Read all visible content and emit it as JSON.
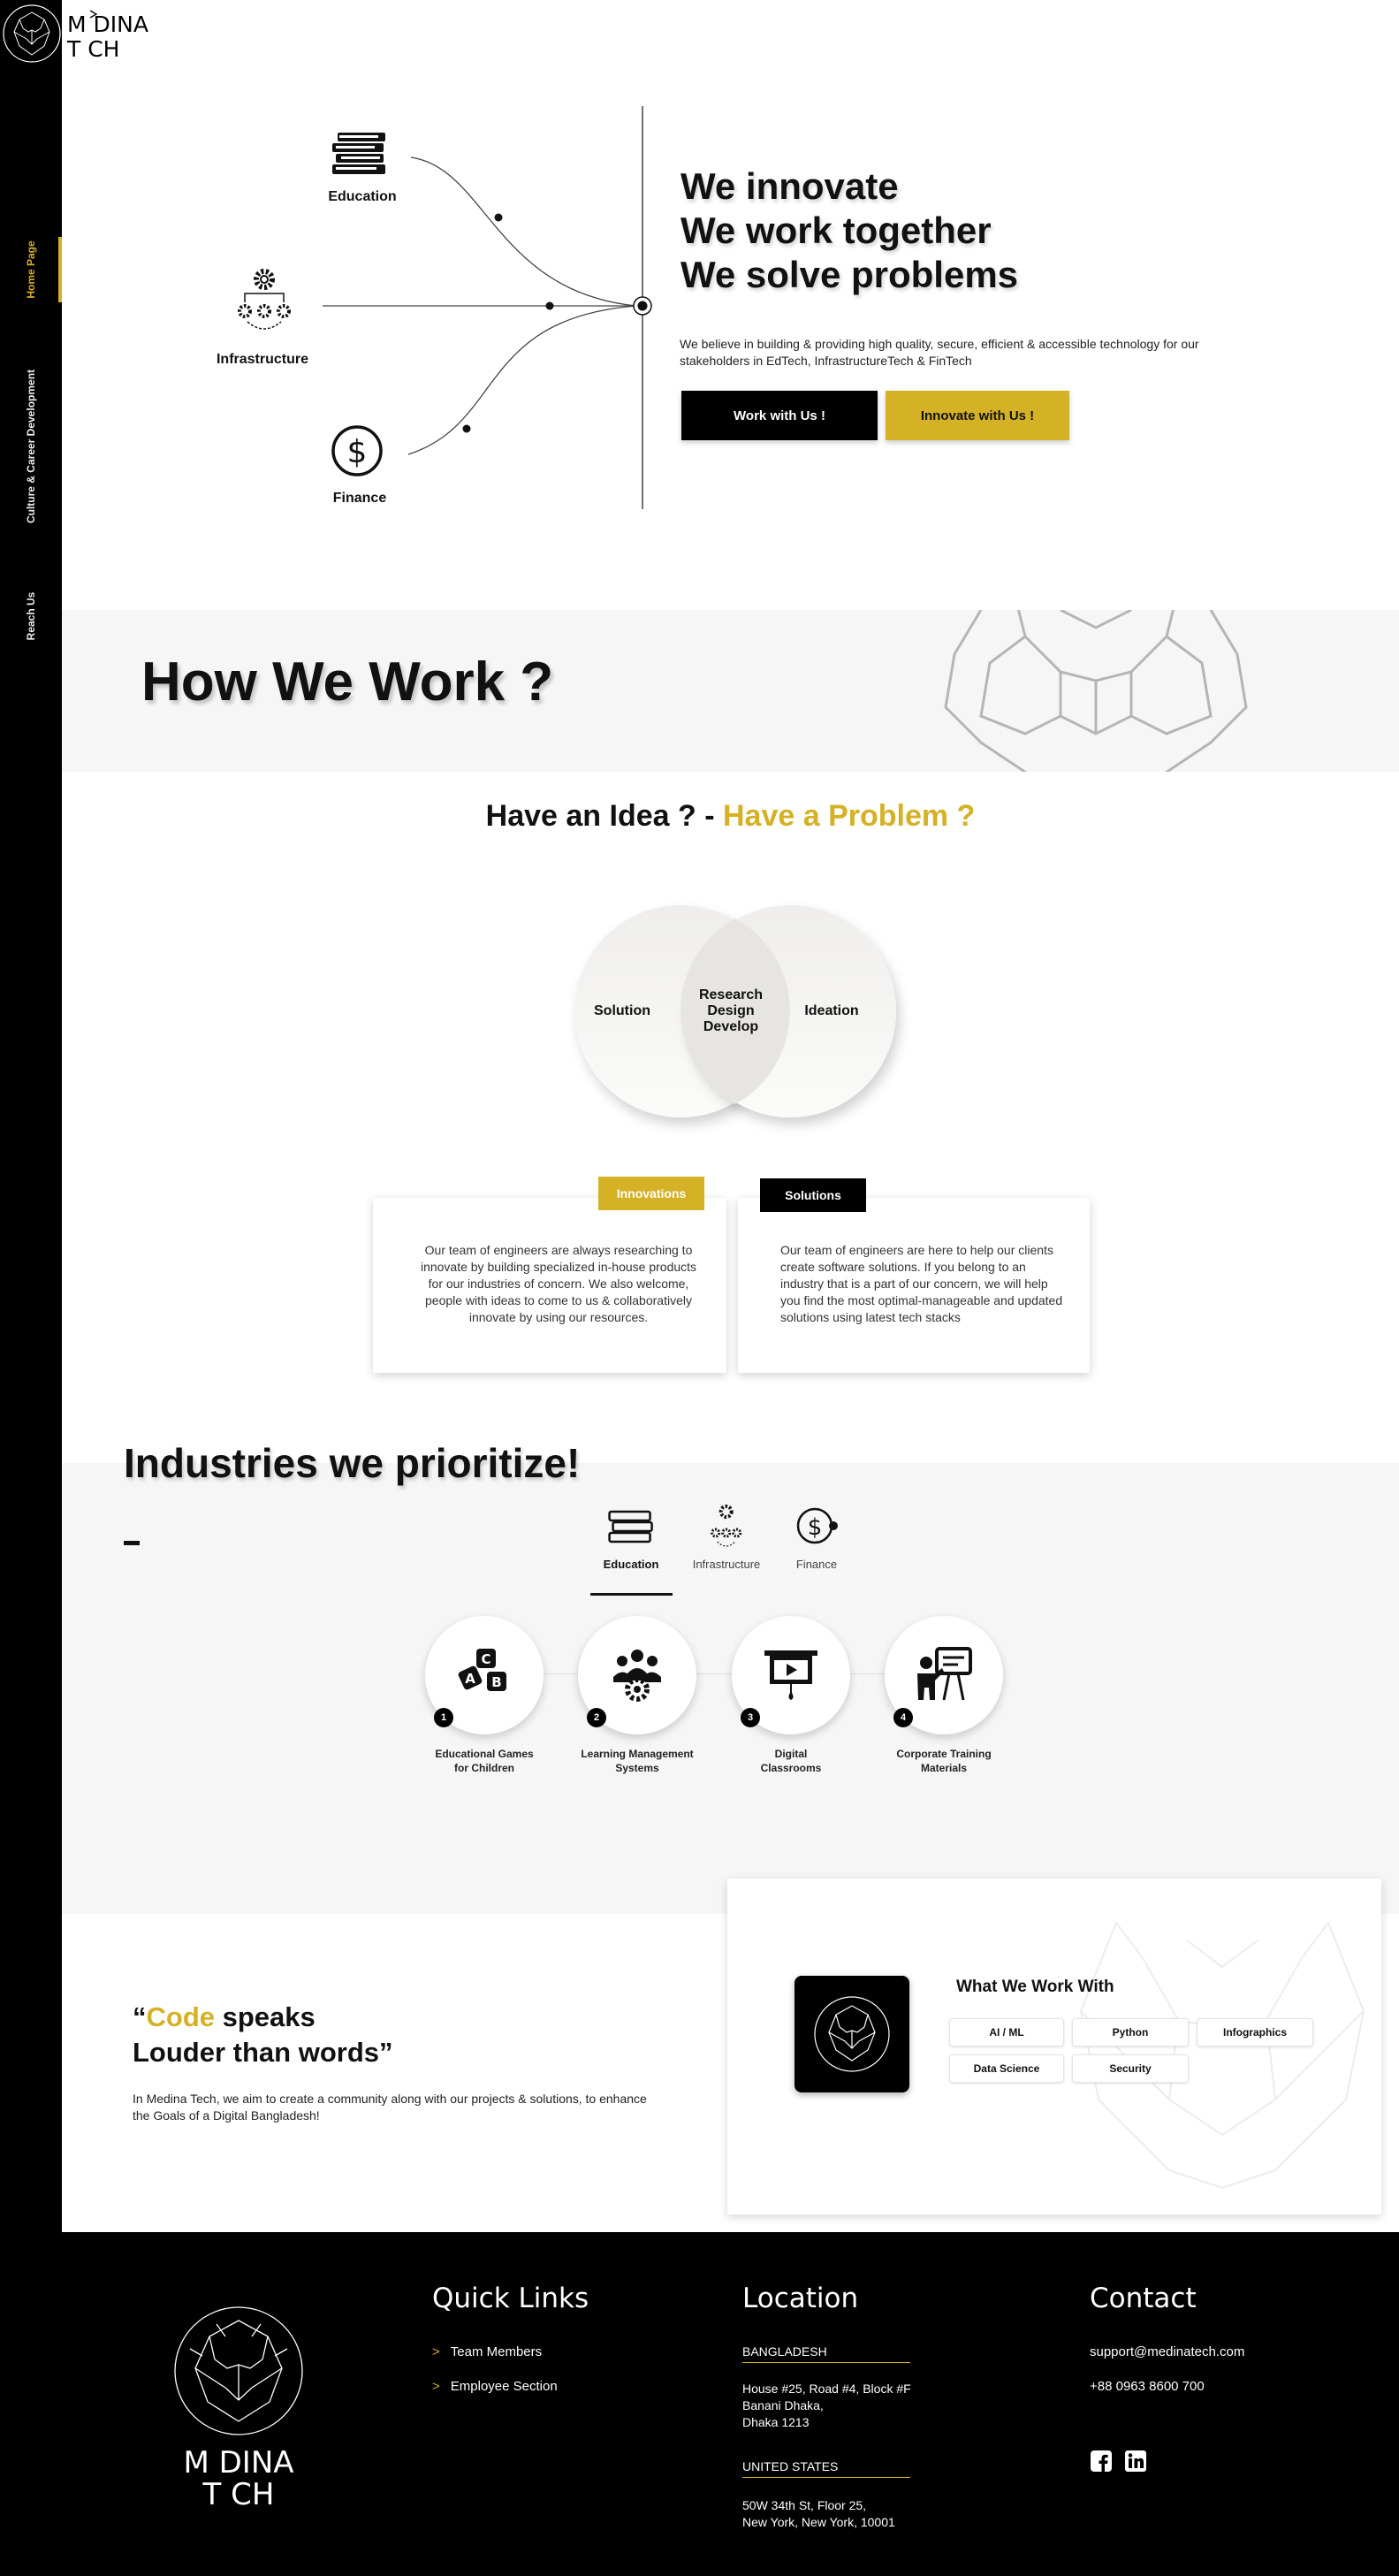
{
  "brand": {
    "name_top": "M DINA",
    "name_bottom": "T CH"
  },
  "sidebar": {
    "items": [
      {
        "label": "Home Page",
        "active": true
      },
      {
        "label": "Culture & Career Development",
        "active": false
      },
      {
        "label": "Reach Us",
        "active": false
      }
    ]
  },
  "hero": {
    "diagram": {
      "education": "Education",
      "infrastructure": "Infrastructure",
      "finance": "Finance"
    },
    "title_lines": [
      "We innovate",
      "We work together",
      "We solve problems"
    ],
    "description": "We believe in building & providing high quality, secure, efficient & accessible technology for our stakeholders in EdTech, InfrastructureTech & FinTech",
    "btn_primary": "Work with Us !",
    "btn_secondary": "Innovate with Us !"
  },
  "how": {
    "title": "How We Work ?",
    "idea_prefix": "Have an Idea ? - ",
    "idea_highlight": "Have a Problem ?",
    "venn": {
      "left": "Solution",
      "center_lines": [
        "Research",
        "Design",
        "Develop"
      ],
      "right": "Ideation"
    },
    "cards": [
      {
        "tag": "Innovations",
        "text": "Our team of engineers are always researching to innovate by building specialized in-house products for our industries of concern. We also welcome, people with ideas to come to us & collaboratively innovate by using our resources."
      },
      {
        "tag": "Solutions",
        "text": "Our team of engineers are here to help our clients create software solutions. If you belong to an industry that is a part of our concern, we will help you find the most optimal-manageable and updated solutions using latest tech stacks"
      }
    ]
  },
  "industries": {
    "title": "Industries we prioritize!",
    "tabs": [
      {
        "label": "Education",
        "icon": "books-icon",
        "active": true
      },
      {
        "label": "Infrastructure",
        "icon": "gears-icon",
        "active": false
      },
      {
        "label": "Finance",
        "icon": "dollar-icon",
        "active": false
      }
    ],
    "items": [
      {
        "num": "1",
        "label_lines": [
          "Educational Games",
          "for Children"
        ],
        "icon": "abc-blocks-icon"
      },
      {
        "num": "2",
        "label_lines": [
          "Learning Management",
          "Systems"
        ],
        "icon": "team-gear-icon"
      },
      {
        "num": "3",
        "label_lines": [
          "Digital",
          "Classrooms"
        ],
        "icon": "presentation-play-icon"
      },
      {
        "num": "4",
        "label_lines": [
          "Corporate Training",
          "Materials"
        ],
        "icon": "trainer-board-icon"
      }
    ]
  },
  "code": {
    "quote_open": "“",
    "quote_highlight": "Code",
    "quote_rest1": " speaks",
    "quote_line2": "Louder than words”",
    "description": "In Medina Tech, we aim to create a community along with our projects & solutions, to enhance the Goals of a Digital Bangladesh!",
    "work_title": "What We Work With",
    "chips": [
      "AI / ML",
      "Python",
      "Infographics",
      "Data Science",
      "Security"
    ]
  },
  "footer": {
    "quick_links_title": "Quick Links",
    "links": [
      "Team Members",
      "Employee Section"
    ],
    "location_title": "Location",
    "locations": [
      {
        "country": "BANGLADESH",
        "address_lines": [
          "House #25, Road #4, Block #F",
          "Banani Dhaka,",
          "Dhaka 1213"
        ]
      },
      {
        "country": "UNITED STATES",
        "address_lines": [
          "50W 34th St, Floor 25,",
          "New York, New York, 10001"
        ]
      }
    ],
    "contact_title": "Contact",
    "email": "support@medinatech.com",
    "phone": "+88 0963 8600 700",
    "social": [
      "facebook-icon",
      "linkedin-icon"
    ]
  },
  "colors": {
    "gold": "#d4b125",
    "black": "#000000",
    "band": "#f6f6f6"
  }
}
